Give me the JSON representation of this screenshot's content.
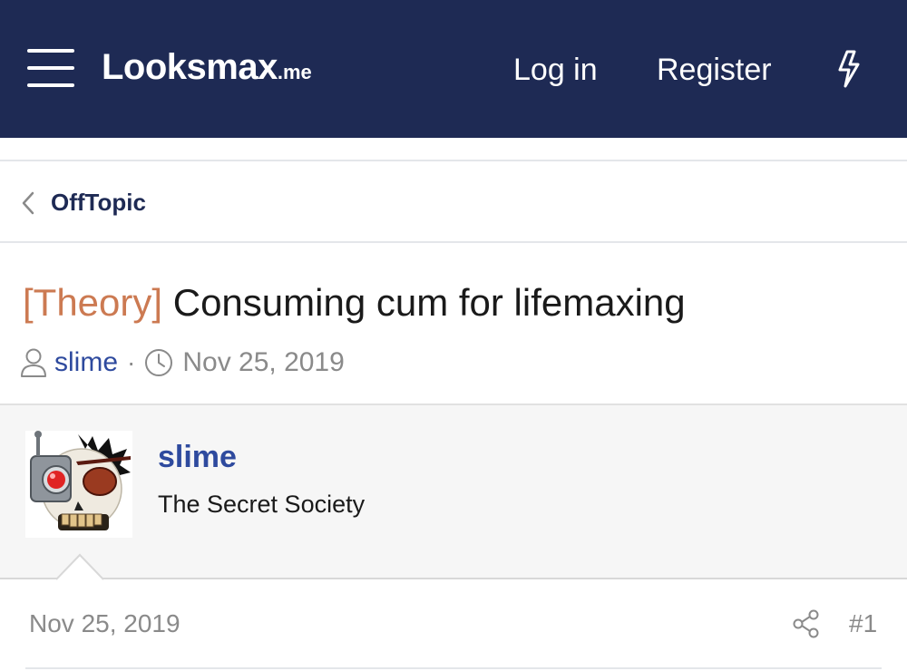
{
  "header": {
    "logo_brand": "Looksmax",
    "logo_tld": ".me",
    "login_label": "Log in",
    "register_label": "Register",
    "bg_color": "#1e2a54"
  },
  "breadcrumb": {
    "label": "OffTopic"
  },
  "thread": {
    "prefix": "[Theory]",
    "title": "Consuming cum for lifemaxing",
    "author": "slime",
    "separator": "·",
    "date": "Nov 25, 2019",
    "prefix_color": "#cc7a52"
  },
  "post": {
    "username": "slime",
    "user_title": "The Secret Society",
    "date": "Nov 25, 2019",
    "number": "#1"
  },
  "icons": {
    "menu": "hamburger-icon",
    "alerts": "bolt-icon",
    "back": "chevron-left-icon",
    "author": "user-icon",
    "date": "clock-icon",
    "share": "share-icon"
  }
}
